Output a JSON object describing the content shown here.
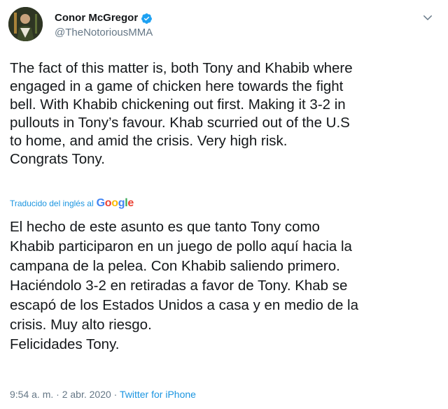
{
  "author": {
    "display_name": "Conor McGregor",
    "handle": "@TheNotoriousMMA",
    "verified": true,
    "avatar_icon": "user-avatar"
  },
  "tweet": {
    "text_en": "The fact of this matter is, both Tony and Khabib where\nengaged in a game of chicken here towards the fight\nbell. With Khabib chickening out first. Making it 3-2 in\npullouts in Tony’s favour. Khab scurried out of the U.S\nto home, and amid the crisis. Very high risk.\nCongrats Tony.",
    "translated_label": "Traducido del inglés al",
    "translator_logo": "Google",
    "text_es": "El hecho de este asunto es que tanto Tony como\nKhabib participaron en un juego de pollo aquí hacia la\ncampana de la pelea. Con Khabib saliendo primero.\nHaciéndolo 3-2 en retiradas a favor de Tony. Khab se\nescapó de los Estados Unidos a casa y en medio de la\ncrisis. Muy alto riesgo.\n Felicidades Tony."
  },
  "meta": {
    "time": "9:54 a. m.",
    "separator1": " · ",
    "date": "2 abr. 2020",
    "separator2": " · ",
    "source": "Twitter for iPhone"
  },
  "colors": {
    "link": "#1b95e0",
    "muted": "#657786",
    "text": "#14171a"
  }
}
